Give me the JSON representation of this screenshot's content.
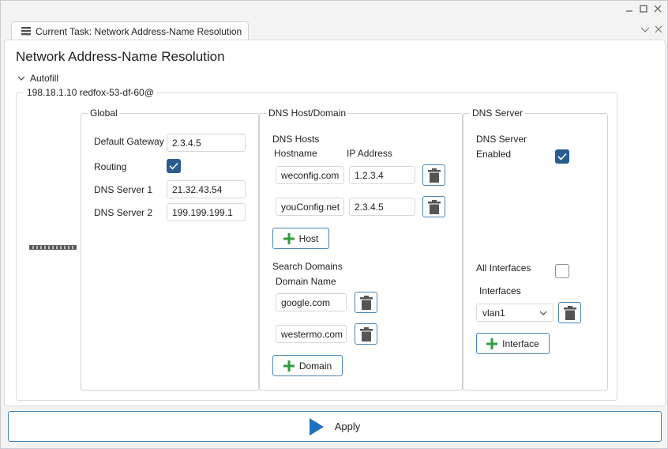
{
  "tab": {
    "title": "Current Task: Network Address-Name Resolution"
  },
  "page": {
    "title": "Network Address-Name Resolution"
  },
  "autofill": {
    "label": "Autofill"
  },
  "device": {
    "label": "198.18.1.10 redfox-53-df-60@"
  },
  "global": {
    "legend": "Global",
    "default_gateway_label": "Default Gateway",
    "default_gateway_value": "2.3.4.5",
    "routing_label": "Routing",
    "routing_checked": true,
    "dns_server1_label": "DNS Server 1",
    "dns_server1_value": "21.32.43.54",
    "dns_server2_label": "DNS Server 2",
    "dns_server2_value": "199.199.199.1"
  },
  "dns_host_domain": {
    "legend": "DNS Host/Domain",
    "dns_hosts_label": "DNS Hosts",
    "hostname_header": "Hostname",
    "ip_header": "IP Address",
    "hosts": [
      {
        "hostname": "weconfig.com",
        "ip": "1.2.3.4"
      },
      {
        "hostname": "youConfig.net",
        "ip": "2.3.4.5"
      }
    ],
    "add_host_label": "Host",
    "search_domains_label": "Search Domains",
    "domain_name_header": "Domain Name",
    "domains": [
      "google.com",
      "westermo.com"
    ],
    "add_domain_label": "Domain"
  },
  "dns_server": {
    "legend": "DNS Server",
    "enabled_label_line1": "DNS Server",
    "enabled_label_line2": "Enabled",
    "enabled_checked": true,
    "all_interfaces_label": "All Interfaces",
    "all_interfaces_checked": false,
    "interfaces_label": "Interfaces",
    "interface_selected": "vlan1",
    "add_interface_label": "Interface"
  },
  "apply": {
    "label": "Apply"
  },
  "colors": {
    "accent": "#2a5d8f",
    "button_border": "#4a86b5",
    "plus_green": "#2e9e3e",
    "apply_arrow": "#1e6fbf"
  },
  "icons": {
    "tab": "list-icon",
    "minimize": "minimize-icon",
    "maximize": "maximize-icon",
    "close": "close-icon",
    "delete": "trash-icon",
    "add": "plus-icon",
    "apply": "play-icon",
    "collapse": "chevron-down-icon"
  }
}
